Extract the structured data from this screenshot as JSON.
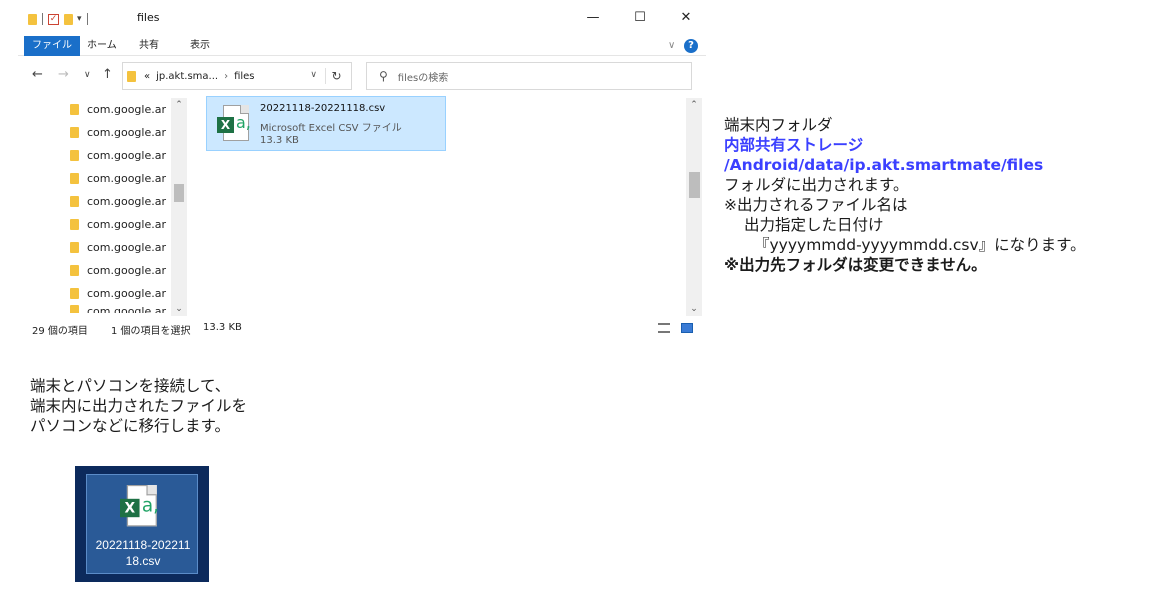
{
  "window": {
    "title": "files",
    "tabs": [
      "ファイル",
      "ホーム",
      "共有",
      "表示"
    ],
    "min_glyph": "—",
    "max_glyph": "☐",
    "close_glyph": "✕",
    "help_glyph": "?"
  },
  "address": {
    "prefix": "«",
    "crumb1": "jp.akt.sma...",
    "sep": "›",
    "crumb2": "files"
  },
  "search": {
    "placeholder": "filesの検索"
  },
  "nav_items": [
    "com.google.ar",
    "com.google.ar",
    "com.google.ar",
    "com.google.ar",
    "com.google.ar",
    "com.google.ar",
    "com.google.ar",
    "com.google.ar",
    "com.google.ar",
    "com.google.ar"
  ],
  "file": {
    "name": "20221118-20221118.csv",
    "type": "Microsoft Excel CSV ファイル",
    "size": "13.3 KB"
  },
  "status": {
    "count": "29 個の項目",
    "selected": "1 個の項目を選択",
    "size": "13.3 KB"
  },
  "note": {
    "line1": "端末内フォルダ",
    "path1": "内部共有ストレージ",
    "path2": "/Android/data/ip.akt.smartmate/files",
    "line2": "フォルダに出力されます。",
    "line3": "※出力されるファイル名は",
    "line4": "出力指定した日付け",
    "line5": "『yyyymmdd-yyyymmdd.csv』になります。",
    "line6": "※出力先フォルダは変更できません。"
  },
  "bottom": {
    "line1": "端末とパソコンを接続して、",
    "line2": "端末内に出力されたファイルを",
    "line3": "パソコンなどに移行します。"
  },
  "desktop": {
    "label1": "20221118-202211",
    "label2": "18.csv"
  },
  "colors": {
    "accent": "#1a6fc9",
    "selection": "#cce8ff",
    "note_blue": "#3b40ff",
    "excel_green": "#1e7145"
  }
}
